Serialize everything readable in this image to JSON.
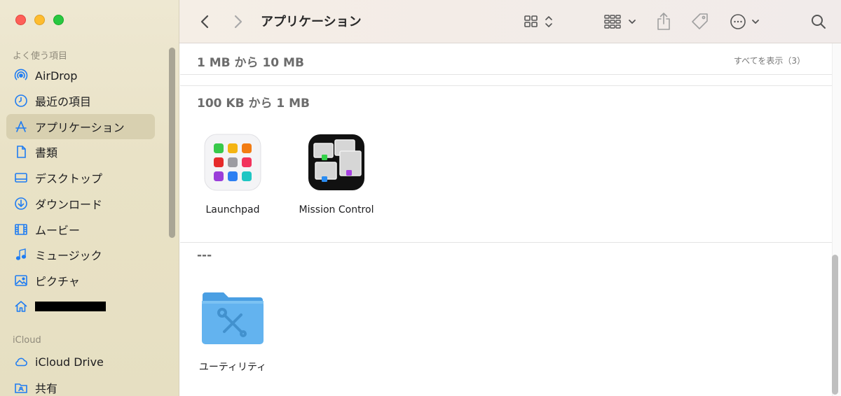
{
  "window": {
    "title": "アプリケーション"
  },
  "sidebar": {
    "favorites_label": "よく使う項目",
    "favorites": [
      {
        "label": "AirDrop",
        "icon": "airdrop-icon"
      },
      {
        "label": "最近の項目",
        "icon": "clock-icon"
      },
      {
        "label": "アプリケーション",
        "icon": "applications-icon",
        "active": true
      },
      {
        "label": "書類",
        "icon": "document-icon"
      },
      {
        "label": "デスクトップ",
        "icon": "desktop-icon"
      },
      {
        "label": "ダウンロード",
        "icon": "download-icon"
      },
      {
        "label": "ムービー",
        "icon": "movie-icon"
      },
      {
        "label": "ミュージック",
        "icon": "music-icon"
      },
      {
        "label": "ピクチャ",
        "icon": "picture-icon"
      },
      {
        "label": "",
        "icon": "home-icon",
        "redacted": true
      }
    ],
    "icloud_label": "iCloud",
    "icloud": [
      {
        "label": "iCloud Drive",
        "icon": "cloud-icon"
      },
      {
        "label": "共有",
        "icon": "shared-folder-icon"
      }
    ]
  },
  "toolbar": {
    "icons": [
      "back-icon",
      "forward-icon",
      "grid-view-icon",
      "group-icon",
      "share-icon",
      "tag-icon",
      "more-icon",
      "search-icon"
    ]
  },
  "content": {
    "groups": [
      {
        "header": "1 MB から 10 MB",
        "show_all": "すべてを表示（3）",
        "items": []
      },
      {
        "header": "100 KB から 1 MB",
        "items": [
          {
            "label": "Launchpad",
            "icon": "launchpad-icon"
          },
          {
            "label": "Mission Control",
            "icon": "mission-control-icon"
          }
        ]
      },
      {
        "header": "---",
        "items": [
          {
            "label": "ユーティリティ",
            "icon": "utilities-folder-icon"
          }
        ]
      }
    ]
  },
  "colors": {
    "sidebar_accent": "#1f7cf2",
    "folder_blue": "#63b3ef"
  }
}
